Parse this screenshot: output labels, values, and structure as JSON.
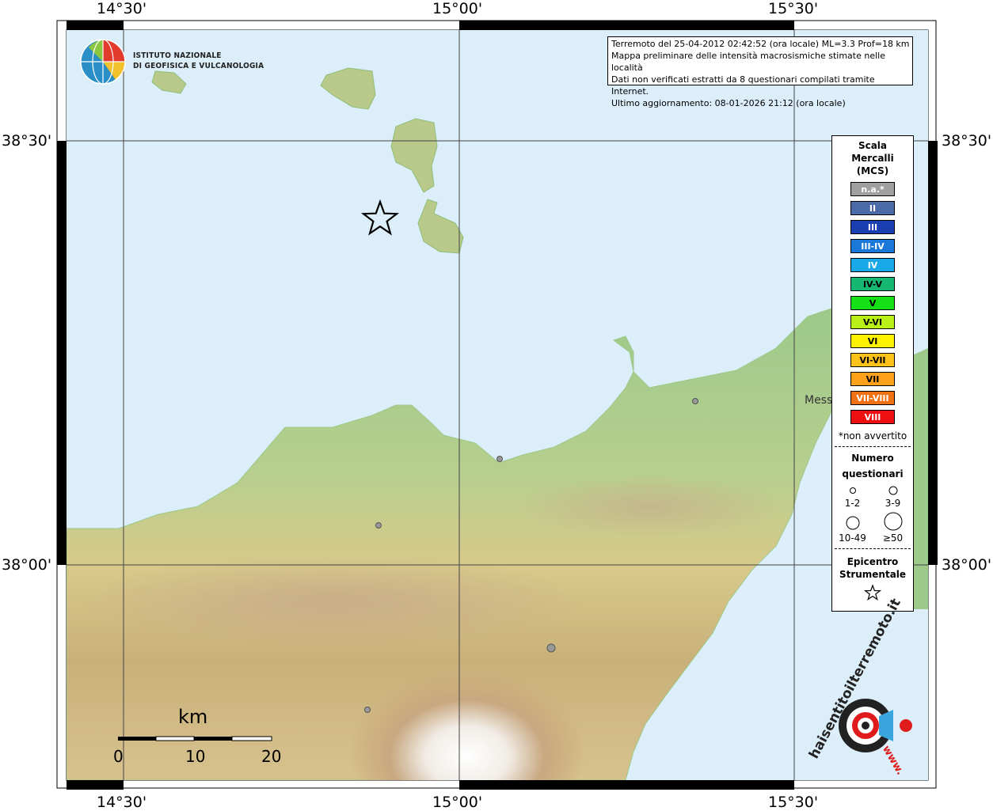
{
  "map": {
    "ticks": {
      "lon_top": [
        "14°30'",
        "15°00'",
        "15°30'"
      ],
      "lon_bottom": [
        "14°30'",
        "15°00'",
        "15°30'"
      ],
      "lat_left": [
        "38°30'",
        "38°00'"
      ],
      "lat_right": [
        "38°30'",
        "38°00'"
      ]
    },
    "city_label": "Mess",
    "scalebar": {
      "unit": "km",
      "labels": [
        "0",
        "10",
        "20"
      ]
    },
    "colors": {
      "sea": "#dbeef9",
      "coast_green": "#8fbf7a",
      "epicenter": "#000000"
    }
  },
  "logo_ingv": {
    "line1": "ISTITUTO NAZIONALE",
    "line2": "DI GEOFISICA E VULCANOLOGIA"
  },
  "info": {
    "line1": "Terremoto del 25-04-2012 02:42:52 (ora locale) ML=3.3 Prof=18 km",
    "line2": "Mappa preliminare delle intensità macrosismiche stimate nelle località",
    "line3": "Dati non verificati estratti da 8 questionari compilati tramite Internet.",
    "line4": "Ultimo aggiornamento: 08-01-2026 21:12 (ora locale)"
  },
  "legend": {
    "title_lines": [
      "Scala",
      "Mercalli",
      "(MCS)"
    ],
    "scale": [
      {
        "label": "n.a.*",
        "color": "#a0a0a0"
      },
      {
        "label": "II",
        "color": "#4a6aa8"
      },
      {
        "label": "III",
        "color": "#1a3fb0"
      },
      {
        "label": "III-IV",
        "color": "#1a78d8"
      },
      {
        "label": "IV",
        "color": "#19a8e8"
      },
      {
        "label": "IV-V",
        "color": "#16b871"
      },
      {
        "label": "V",
        "color": "#16e018"
      },
      {
        "label": "V-VI",
        "color": "#b8f018"
      },
      {
        "label": "VI",
        "color": "#fff200"
      },
      {
        "label": "VI-VII",
        "color": "#ffc21a"
      },
      {
        "label": "VII",
        "color": "#ffa21a"
      },
      {
        "label": "VII-VIII",
        "color": "#f07014"
      },
      {
        "label": "VIII",
        "color": "#ee1010"
      }
    ],
    "note": "*non avvertito",
    "questionari_title": [
      "Numero",
      "questionari"
    ],
    "questionari": [
      "1-2",
      "3-9",
      "10-49",
      "≥50"
    ],
    "epicentro_title": [
      "Epicentro",
      "Strumentale"
    ]
  },
  "hsit_logo": {
    "text": "haisentitoilterremoto.it",
    "www": "www."
  }
}
